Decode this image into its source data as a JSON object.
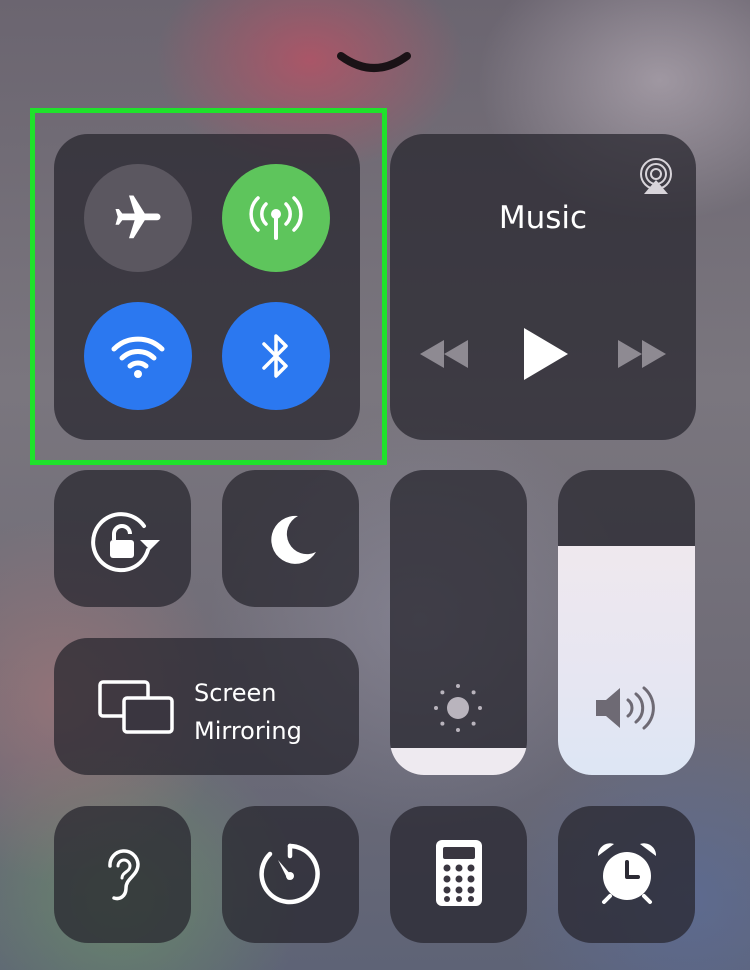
{
  "control_center": {
    "connectivity": {
      "airplane_mode": {
        "icon": "airplane-icon",
        "active": false,
        "color": "#5b5760"
      },
      "cellular_data": {
        "icon": "antenna-icon",
        "active": true,
        "color": "#5ec55c"
      },
      "wifi": {
        "icon": "wifi-icon",
        "active": true,
        "color": "#2b78f0"
      },
      "bluetooth": {
        "icon": "bluetooth-icon",
        "active": true,
        "color": "#2b78f0"
      }
    },
    "music": {
      "title": "Music",
      "icons": [
        "airplay-icon",
        "rewind-icon",
        "play-icon",
        "fast-forward-icon"
      ]
    },
    "orientation_lock": {
      "icon": "rotation-lock-icon"
    },
    "do_not_disturb": {
      "icon": "moon-icon"
    },
    "screen_mirroring": {
      "line1": "Screen",
      "line2": "Mirroring",
      "icon": "screen-mirroring-icon"
    },
    "brightness": {
      "icon": "sun-icon",
      "level": 0.09
    },
    "volume": {
      "icon": "speaker-icon",
      "level": 0.75
    },
    "bottom_row": [
      "ear-icon",
      "timer-icon",
      "calculator-icon",
      "alarm-clock-icon"
    ],
    "highlight_color": "#1fe22b"
  }
}
